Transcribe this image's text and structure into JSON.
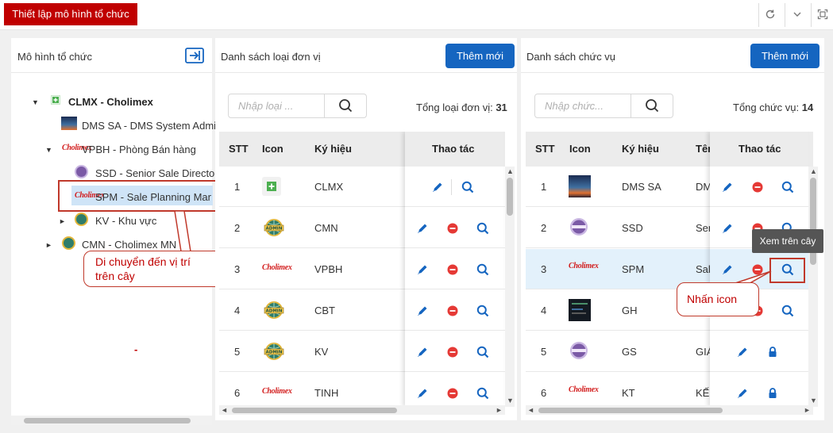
{
  "app": {
    "title_tab": "Thiết lập mô hình tổ chức"
  },
  "toolbar": {
    "icons": [
      "refresh-icon",
      "chevron-down-icon",
      "fullscreen-icon"
    ]
  },
  "tree_panel": {
    "title": "Mô hình tổ chức",
    "nodes": [
      {
        "label": "CLMX - Cholimex",
        "level": 0,
        "expanded": true,
        "icon": "plus-square-icon"
      },
      {
        "label": "DMS SA - DMS System Admin",
        "level": 1,
        "icon": "dms-thumbnail"
      },
      {
        "label": "VPBH - Phòng Bán hàng",
        "level": 1,
        "expanded": true,
        "icon": "cholimex-logo"
      },
      {
        "label": "SSD - Senior Sale Director",
        "level": 2,
        "icon": "purple-seal-logo"
      },
      {
        "label": "SPM - Sale Planning Manager",
        "level": 2,
        "icon": "cholimex-logo",
        "selected": true
      },
      {
        "label": "KV - Khu vực",
        "level": 2,
        "expanded": false,
        "icon": "globe-admin-logo"
      },
      {
        "label": "CMN - Cholimex MN",
        "level": 1,
        "expanded": false,
        "icon": "globe-admin-logo"
      }
    ],
    "callout": "Di chuyển đến vị trí trên cây",
    "dash": "-"
  },
  "unit_panel": {
    "title": "Danh sách loại đơn vị",
    "add_button": "Thêm mới",
    "search_placeholder": "Nhập loại ...",
    "count_label": "Tổng loại đơn vị:",
    "count_value": "31",
    "headers": {
      "stt": "STT",
      "icon": "Icon",
      "code": "Ký hiệu",
      "actions": "Thao tác"
    },
    "rows": [
      {
        "stt": "1",
        "icon": "plus-square-icon",
        "code": "CLMX",
        "delete": false
      },
      {
        "stt": "2",
        "icon": "globe-admin-logo",
        "code": "CMN",
        "delete": true
      },
      {
        "stt": "3",
        "icon": "cholimex-logo",
        "code": "VPBH",
        "delete": true
      },
      {
        "stt": "4",
        "icon": "globe-admin-logo",
        "code": "CBT",
        "delete": true
      },
      {
        "stt": "5",
        "icon": "globe-admin-logo",
        "code": "KV",
        "delete": true
      },
      {
        "stt": "6",
        "icon": "cholimex-logo",
        "code": "TINH",
        "delete": true
      }
    ]
  },
  "position_panel": {
    "title": "Danh sách chức vụ",
    "add_button": "Thêm mới",
    "search_placeholder": "Nhập chức...",
    "count_label": "Tổng chức vụ:",
    "count_value": "14",
    "headers": {
      "stt": "STT",
      "icon": "Icon",
      "code": "Ký hiệu",
      "name": "Tên",
      "actions": "Thao tác"
    },
    "rows": [
      {
        "stt": "1",
        "icon": "dms-thumbnail",
        "code": "DMS SA",
        "name": "DMS",
        "action": "delete"
      },
      {
        "stt": "2",
        "icon": "purple-seal-logo",
        "code": "SSD",
        "name": "Senior",
        "action": "delete"
      },
      {
        "stt": "3",
        "icon": "cholimex-logo",
        "code": "SPM",
        "name": "Sale",
        "action": "delete",
        "highlight": true
      },
      {
        "stt": "4",
        "icon": "dark-thumbnail",
        "code": "GH",
        "name": "",
        "action": "delete"
      },
      {
        "stt": "5",
        "icon": "purple-seal-logo",
        "code": "GS",
        "name": "GIÁM",
        "action": "lock"
      },
      {
        "stt": "6",
        "icon": "cholimex-logo",
        "code": "KT",
        "name": "KẾ",
        "action": "lock"
      }
    ],
    "tooltip": "Xem trên cây",
    "callout": "Nhấn icon"
  },
  "colors": {
    "accent": "#1565c0",
    "brand_red": "#c00000",
    "delete_red": "#e53935",
    "highlight_row": "#e3f1fb"
  }
}
